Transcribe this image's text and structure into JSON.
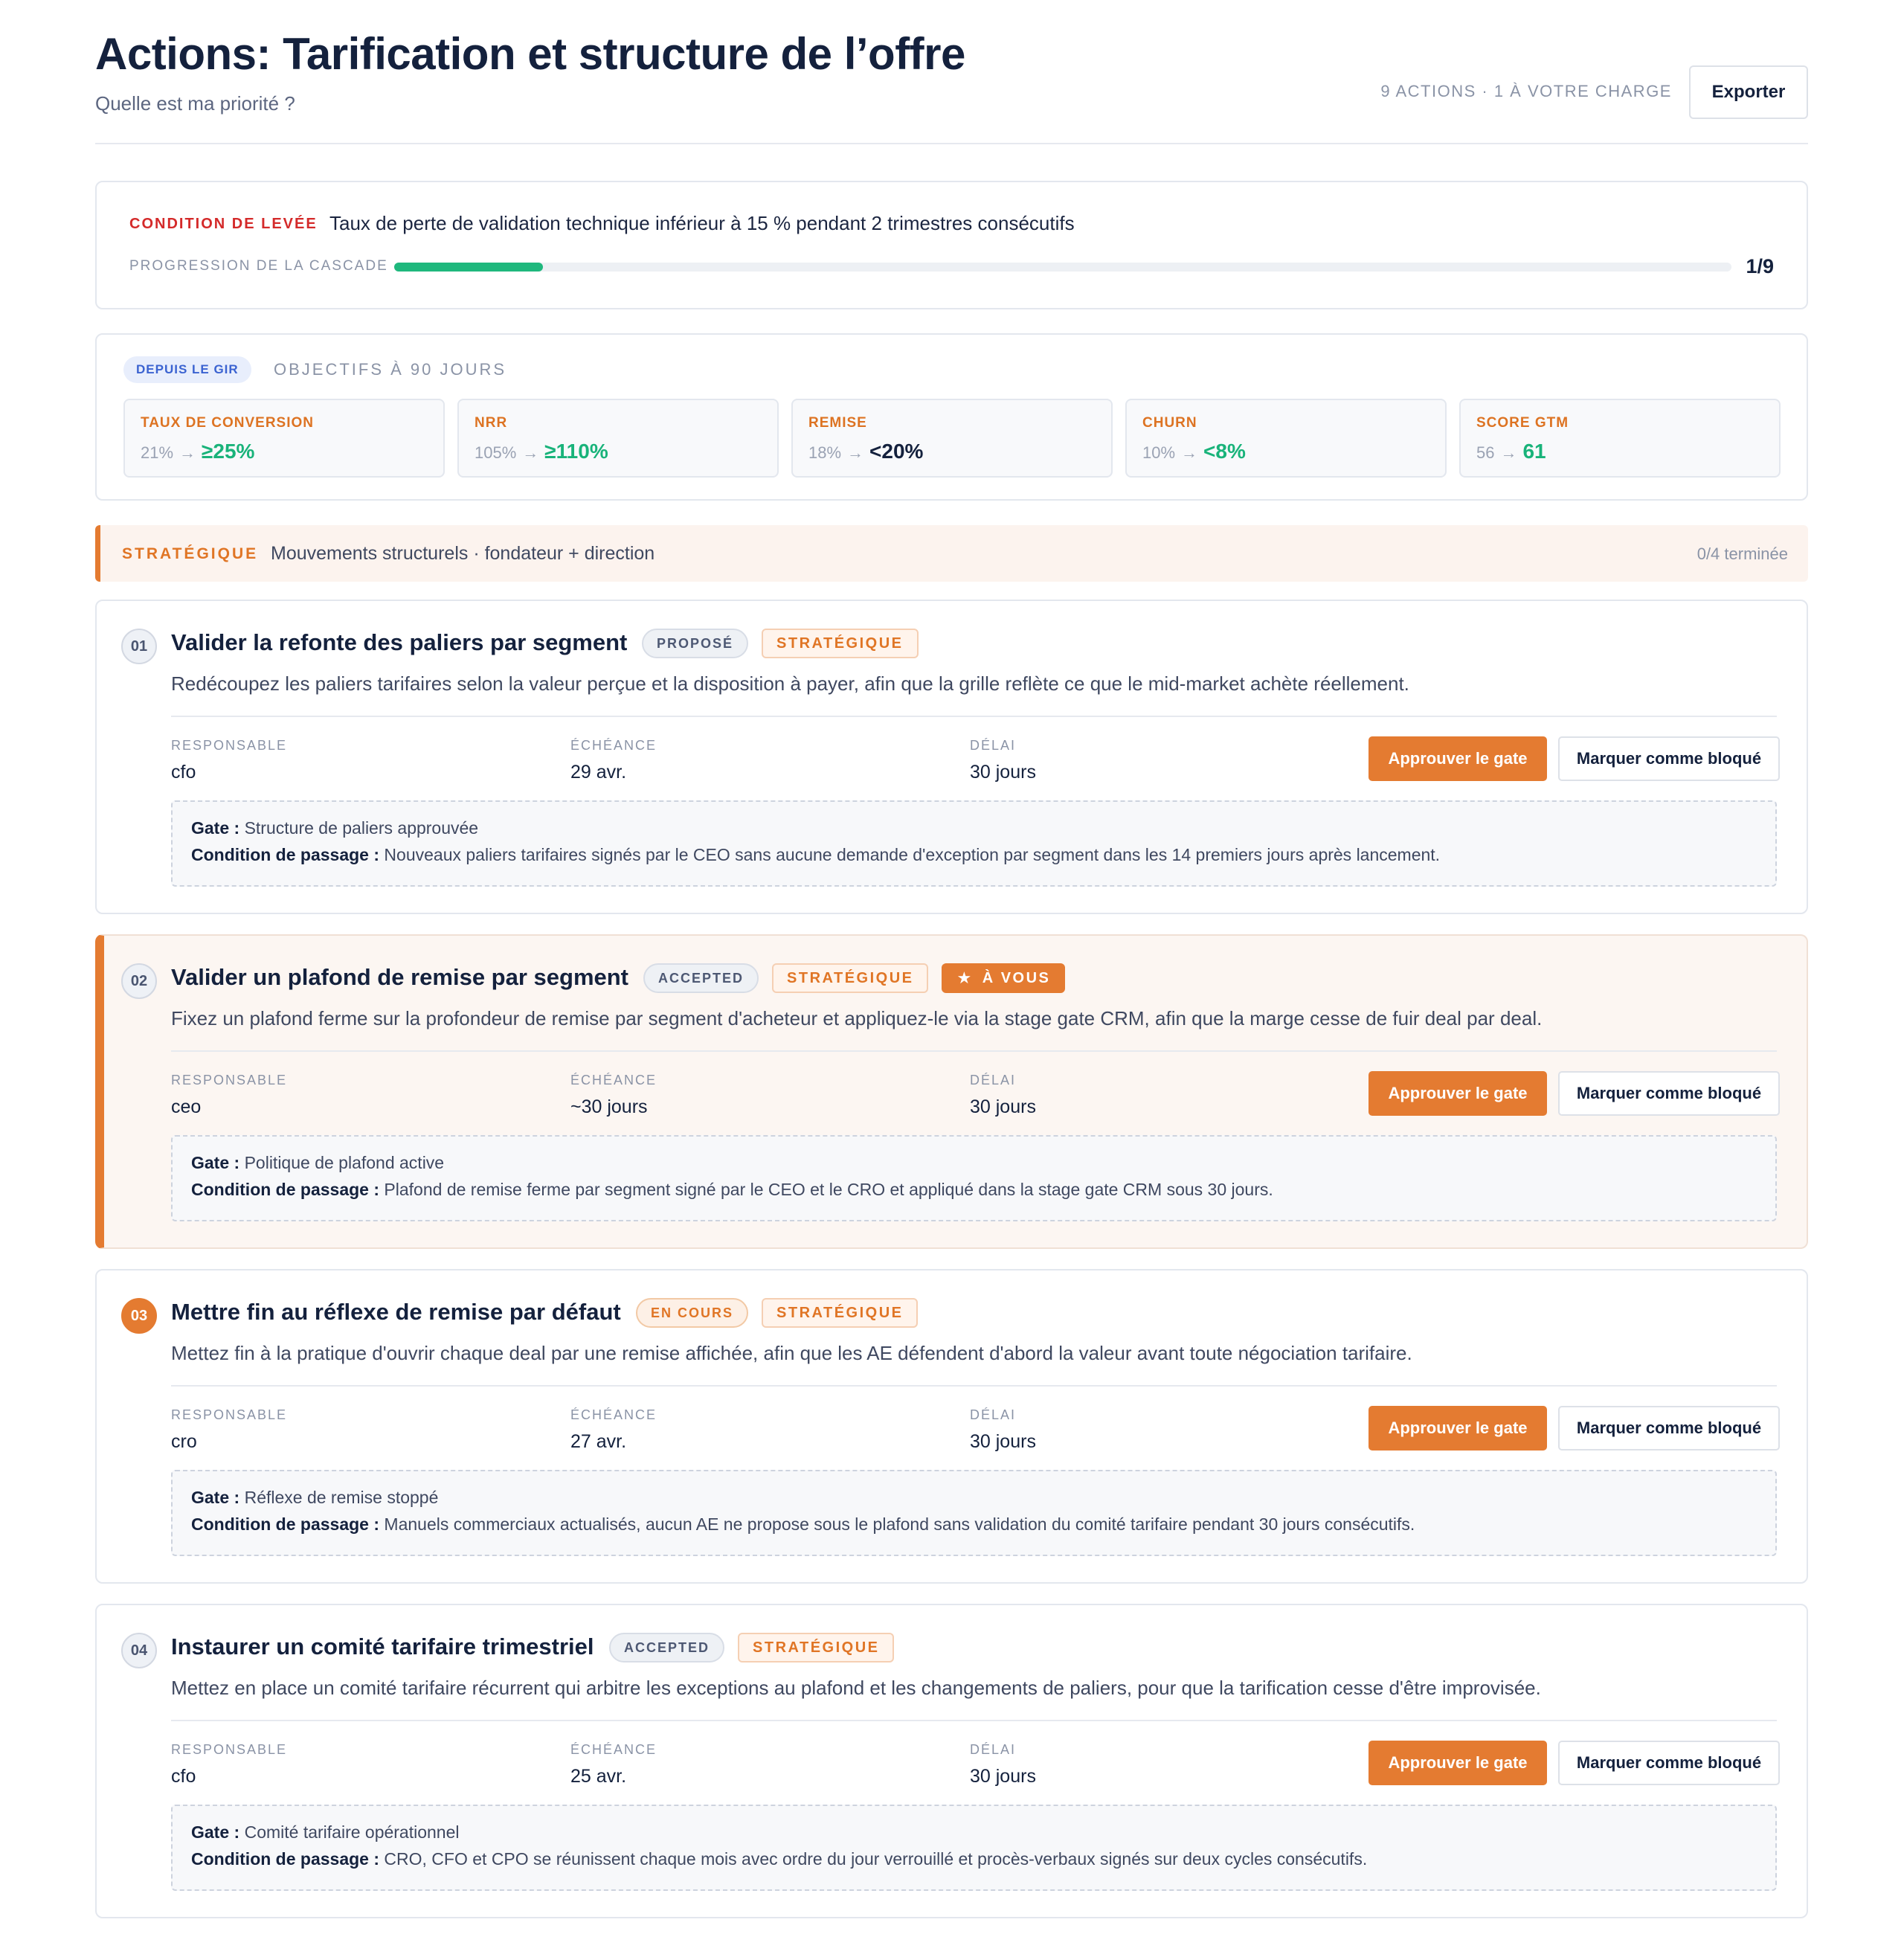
{
  "header": {
    "title": "Actions: Tarification et structure de l’offre",
    "subtitle": "Quelle est ma priorité ?",
    "meta": "9 ACTIONS · 1 À VOTRE CHARGE",
    "export_label": "Exporter"
  },
  "lift": {
    "label": "CONDITION DE LEVÉE",
    "text": "Taux de perte de validation technique inférieur à 15 % pendant 2 trimestres consécutifs",
    "progress_label": "PROGRESSION DE LA CASCADE",
    "progress_count": "1/9",
    "progress_fraction": 0.111
  },
  "objectives": {
    "pill": "DEPUIS LE GIR",
    "title": "OBJECTIFS À 90 JOURS",
    "kpis": [
      {
        "name": "TAUX DE CONVERSION",
        "from": "21%",
        "to": "≥25%",
        "to_color": "green"
      },
      {
        "name": "NRR",
        "from": "105%",
        "to": "≥110%",
        "to_color": "green"
      },
      {
        "name": "REMISE",
        "from": "18%",
        "to": "<20%",
        "to_color": "dark"
      },
      {
        "name": "CHURN",
        "from": "10%",
        "to": "<8%",
        "to_color": "green"
      },
      {
        "name": "SCORE GTM",
        "from": "56",
        "to": "61",
        "to_color": "green"
      }
    ]
  },
  "section": {
    "tag": "STRATÉGIQUE",
    "desc": "Mouvements structurels · fondateur + direction",
    "count": "0/4 terminée"
  },
  "labels": {
    "responsable": "RESPONSABLE",
    "echeance": "ÉCHÉANCE",
    "delai": "DÉLAI",
    "approve": "Approuver le gate",
    "block": "Marquer comme bloqué",
    "gate": "Gate :",
    "condition": "Condition de passage :",
    "strat_badge": "STRATÉGIQUE",
    "avous_badge": "À VOUS"
  },
  "actions": [
    {
      "num": "01",
      "title": "Valider la refonte des paliers par segment",
      "status": "PROPOSÉ",
      "desc": "Redécoupez les paliers tarifaires selon la valeur perçue et la disposition à payer, afin que la grille reflète ce que le mid-market achète réellement.",
      "responsable": "cfo",
      "echeance": "29 avr.",
      "delai": "30 jours",
      "gate": "Structure de paliers approuvée",
      "condition": "Nouveaux paliers tarifaires signés par le CEO sans aucune demande d'exception par segment dans les 14 premiers jours après lancement."
    },
    {
      "num": "02",
      "title": "Valider un plafond de remise par segment",
      "status": "ACCEPTED",
      "desc": "Fixez un plafond ferme sur la profondeur de remise par segment d'acheteur et appliquez-le via la stage gate CRM, afin que la marge cesse de fuir deal par deal.",
      "responsable": "ceo",
      "echeance": "~30 jours",
      "delai": "30 jours",
      "gate": "Politique de plafond active",
      "condition": "Plafond de remise ferme par segment signé par le CEO et le CRO et appliqué dans la stage gate CRM sous 30 jours."
    },
    {
      "num": "03",
      "title": "Mettre fin au réflexe de remise par défaut",
      "status": "EN COURS",
      "desc": "Mettez fin à la pratique d'ouvrir chaque deal par une remise affichée, afin que les AE défendent d'abord la valeur avant toute négociation tarifaire.",
      "responsable": "cro",
      "echeance": "27 avr.",
      "delai": "30 jours",
      "gate": "Réflexe de remise stoppé",
      "condition": "Manuels commerciaux actualisés, aucun AE ne propose sous le plafond sans validation du comité tarifaire pendant 30 jours consécutifs."
    },
    {
      "num": "04",
      "title": "Instaurer un comité tarifaire trimestriel",
      "status": "ACCEPTED",
      "desc": "Mettez en place un comité tarifaire récurrent qui arbitre les exceptions au plafond et les changements de paliers, pour que la tarification cesse d'être improvisée.",
      "responsable": "cfo",
      "echeance": "25 avr.",
      "delai": "30 jours",
      "gate": "Comité tarifaire opérationnel",
      "condition": "CRO, CFO et CPO se réunissent chaque mois avec ordre du jour verrouillé et procès-verbaux signés sur deux cycles consécutifs."
    }
  ]
}
